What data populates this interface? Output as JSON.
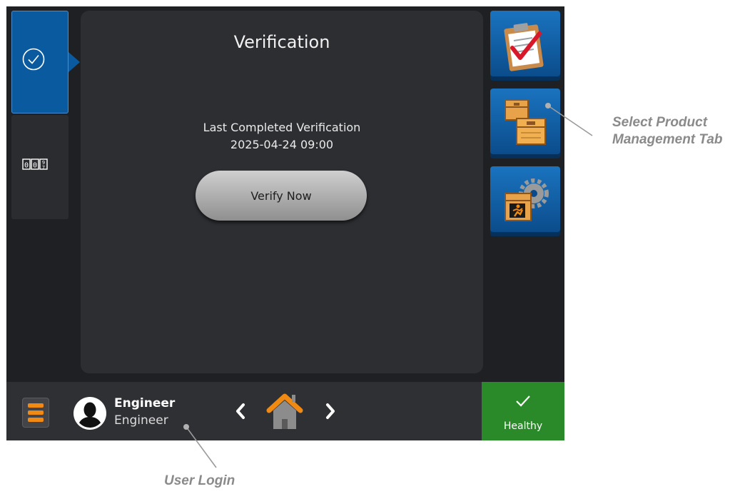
{
  "main": {
    "title": "Verification",
    "last_label": "Last Completed Verification",
    "last_date": "2025-04-24 09:00",
    "verify_button": "Verify Now"
  },
  "left_tabs": [
    {
      "icon": "check-circle-icon",
      "active": true
    },
    {
      "icon": "counter-icon",
      "active": false
    }
  ],
  "right_tabs": [
    {
      "icon": "clipboard-check-icon"
    },
    {
      "icon": "product-boxes-icon"
    },
    {
      "icon": "product-settings-icon"
    }
  ],
  "bottom_bar": {
    "user_name": "Engineer",
    "user_role": "Engineer",
    "status": "Healthy"
  },
  "callouts": {
    "product_line1": "Select Product",
    "product_line2": "Management Tab",
    "login": "User Login"
  },
  "colors": {
    "accent_blue": "#0a5aa0",
    "orange": "#f08a12",
    "healthy_green": "#2a8a2a"
  }
}
